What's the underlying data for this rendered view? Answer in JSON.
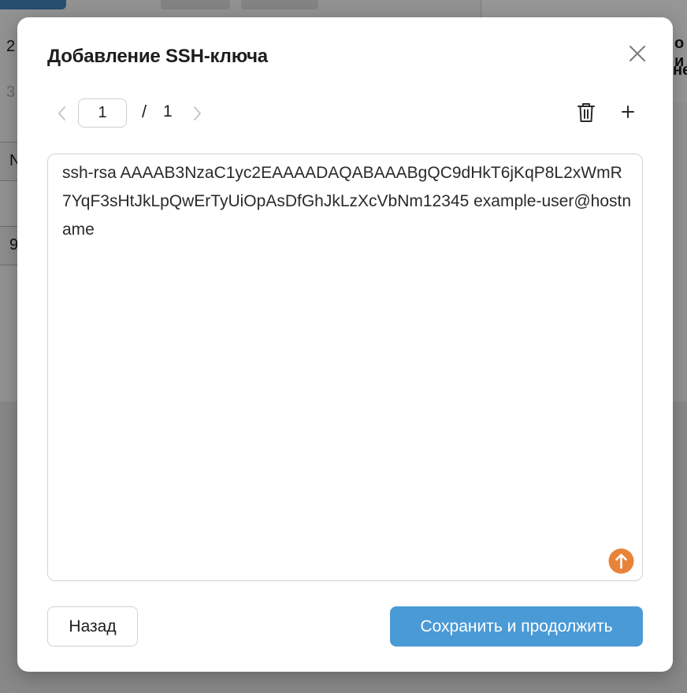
{
  "background": {
    "fragments": [
      "2",
      "3",
      "N",
      "9"
    ],
    "right_fragments": [
      "о и",
      "не"
    ]
  },
  "modal": {
    "title": "Добавление SSH-ключа",
    "pager": {
      "current": "1",
      "separator": "/",
      "total": "1"
    },
    "key_text": "ssh-rsa AAAAB3NzaC1yc2EAAAADAQABAAABgQC9dHkT6jKqP8L2xWmR7YqF3sHtJkLpQwErTyUiOpAsDfGhJkLzXcVbNm12345 example-user@hostname",
    "buttons": {
      "back": "Назад",
      "save": "Сохранить и продолжить"
    }
  },
  "colors": {
    "primary": "#4a9ad6",
    "upload_accent": "#e8833a"
  }
}
